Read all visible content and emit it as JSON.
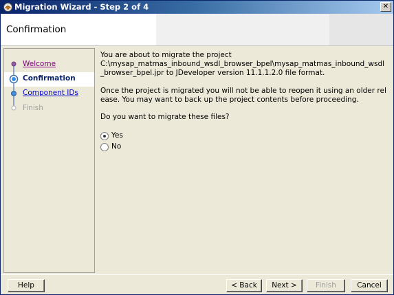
{
  "window": {
    "title": "Migration Wizard - Step 2 of 4",
    "close_glyph": "✕"
  },
  "header": {
    "title": "Confirmation"
  },
  "nav": {
    "items": [
      {
        "label": "Welcome",
        "state": "visited"
      },
      {
        "label": "Confirmation",
        "state": "current"
      },
      {
        "label": "Component IDs",
        "state": "link"
      },
      {
        "label": "Finish",
        "state": "disabled"
      }
    ]
  },
  "content": {
    "line1": "You are about to migrate the project",
    "line2": "C:\\mysap_matmas_inbound_wsdl_browser_bpel\\mysap_matmas_inbound_wsdl_browser_bpel.jpr to JDeveloper version 11.1.1.2.0 file format.",
    "para2": "Once the project is migrated you will not be able to reopen it using an older release. You may want to back up the project contents before proceeding.",
    "question": "Do you want to migrate these files?",
    "options": [
      {
        "label": "Yes",
        "checked": true
      },
      {
        "label": "No",
        "checked": false
      }
    ]
  },
  "buttons": {
    "help": "Help",
    "back": "< Back",
    "next": "Next >",
    "finish": "Finish",
    "cancel": "Cancel"
  }
}
